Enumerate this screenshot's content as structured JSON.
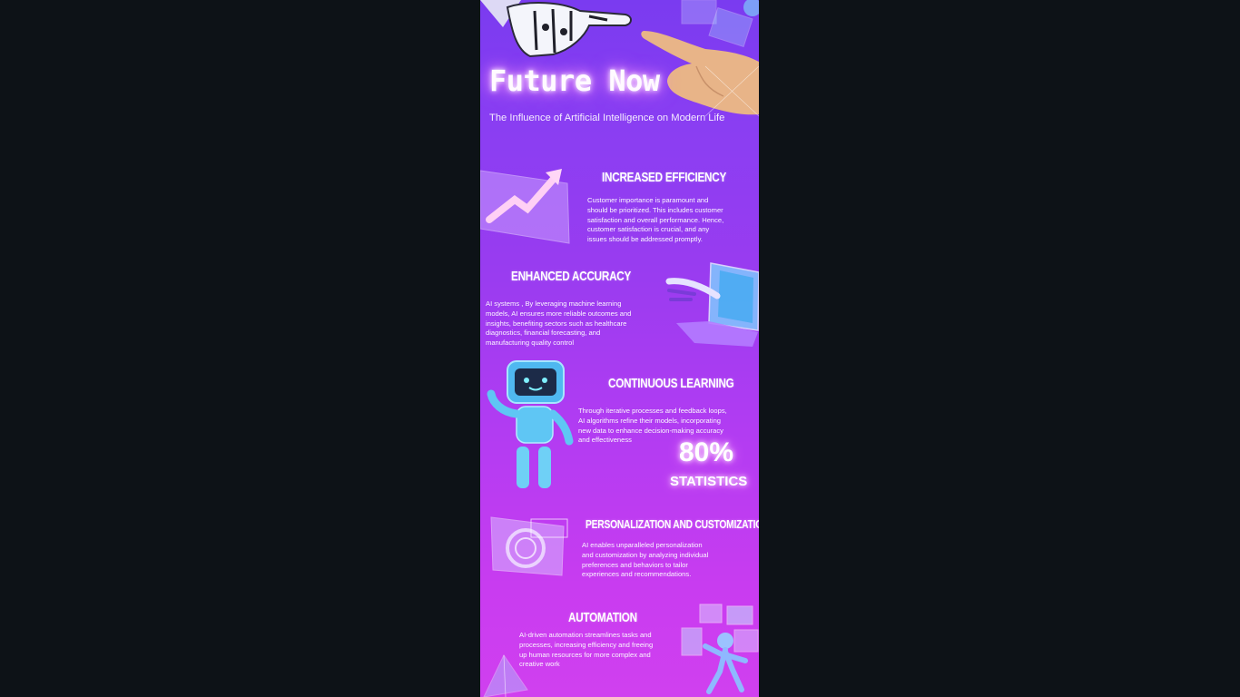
{
  "poster": {
    "title": "Future Now",
    "subtitle": "The Influence of Artificial Intelligence on Modern Life",
    "sections": [
      {
        "heading": "INCREASED EFFICIENCY",
        "body_lines": [
          "Customer importance is paramount and",
          "should be prioritized. This includes customer",
          "satisfaction and overall performance. Hence,",
          "customer satisfaction is crucial, and any",
          "issues should be addressed promptly."
        ],
        "icon": "growth-chart-icon"
      },
      {
        "heading": "ENHANCED ACCURACY",
        "body_lines": [
          "AI systems , By leveraging machine learning",
          "models, AI ensures more reliable outcomes and",
          "insights, benefiting sectors such as healthcare",
          "diagnostics, financial forecasting, and",
          "manufacturing quality control"
        ],
        "icon": "robot-hand-laptop-icon"
      },
      {
        "heading": "CONTINUOUS LEARNING",
        "body_lines": [
          "Through iterative processes and feedback loops,",
          "AI algorithms refine their models, incorporating",
          "new data to enhance decision-making accuracy",
          "and effectiveness"
        ],
        "icon": "robot-character-icon"
      },
      {
        "heading": "PERSONALIZATION AND CUSTOMIZATION",
        "body_lines": [
          "AI enables unparalleled personalization",
          "and customization by analyzing individual",
          "preferences and behaviors to tailor",
          "experiences and recommendations."
        ],
        "icon": "hologram-screen-icon"
      },
      {
        "heading": "AUTOMATION",
        "body_lines": [
          "AI-driven automation streamlines tasks and",
          "processes, increasing efficiency and freeing",
          "up human resources for more complex and",
          "creative work"
        ],
        "icon": "robot-hologram-icon"
      }
    ],
    "stat": {
      "value": "80%",
      "label": "STATISTICS"
    }
  },
  "colors": {
    "viewer_background": "#0d1217",
    "poster_top": "#7a3bf0",
    "poster_bottom": "#d040ef",
    "glow": "#ff9dff"
  }
}
